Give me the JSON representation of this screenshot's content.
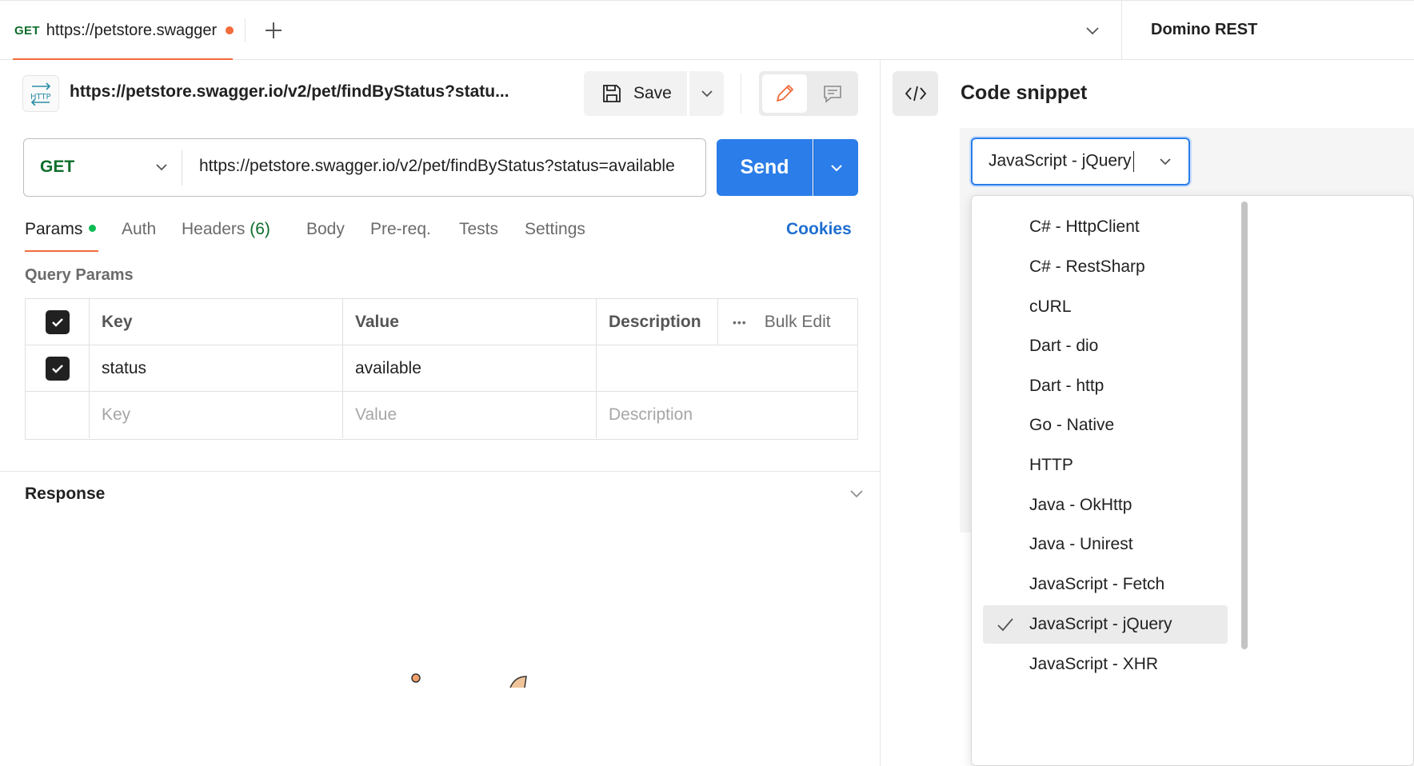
{
  "tab": {
    "method": "GET",
    "title": "https://petstore.swagger.io/v2/pet/findByStatus?status=available",
    "unsaved": true
  },
  "environment": {
    "name": "Domino REST"
  },
  "request": {
    "name": "https://petstore.swagger.io/v2/pet/findByStatus?statu...",
    "badge": "HTTP",
    "save_label": "Save",
    "method": "GET",
    "url": "https://petstore.swagger.io/v2/pet/findByStatus?status=available",
    "send_label": "Send"
  },
  "subtabs": {
    "params": "Params",
    "auth": "Auth",
    "headers": "Headers",
    "headers_count": "(6)",
    "body": "Body",
    "prereq": "Pre-req.",
    "tests": "Tests",
    "settings": "Settings",
    "cookies": "Cookies"
  },
  "query_params": {
    "title": "Query Params",
    "headers": {
      "key": "Key",
      "value": "Value",
      "description": "Description",
      "more": "•••",
      "bulk_edit": "Bulk Edit"
    },
    "rows": [
      {
        "checked": true,
        "key": "status",
        "value": "available",
        "description": ""
      }
    ],
    "placeholders": {
      "key": "Key",
      "value": "Value",
      "description": "Description"
    }
  },
  "response": {
    "title": "Response"
  },
  "snippet": {
    "title": "Code snippet",
    "selected": "JavaScript - jQuery",
    "options": [
      "C# - HttpClient",
      "C# - RestSharp",
      "cURL",
      "Dart - dio",
      "Dart - http",
      "Go - Native",
      "HTTP",
      "Java - OkHttp",
      "Java - Unirest",
      "JavaScript - Fetch",
      "JavaScript - jQuery",
      "JavaScript - XHR"
    ]
  },
  "colors": {
    "accent": "#f26b3a",
    "send": "#2b7de9",
    "method_get": "#0d6d2b",
    "link": "#1f6fd1"
  }
}
